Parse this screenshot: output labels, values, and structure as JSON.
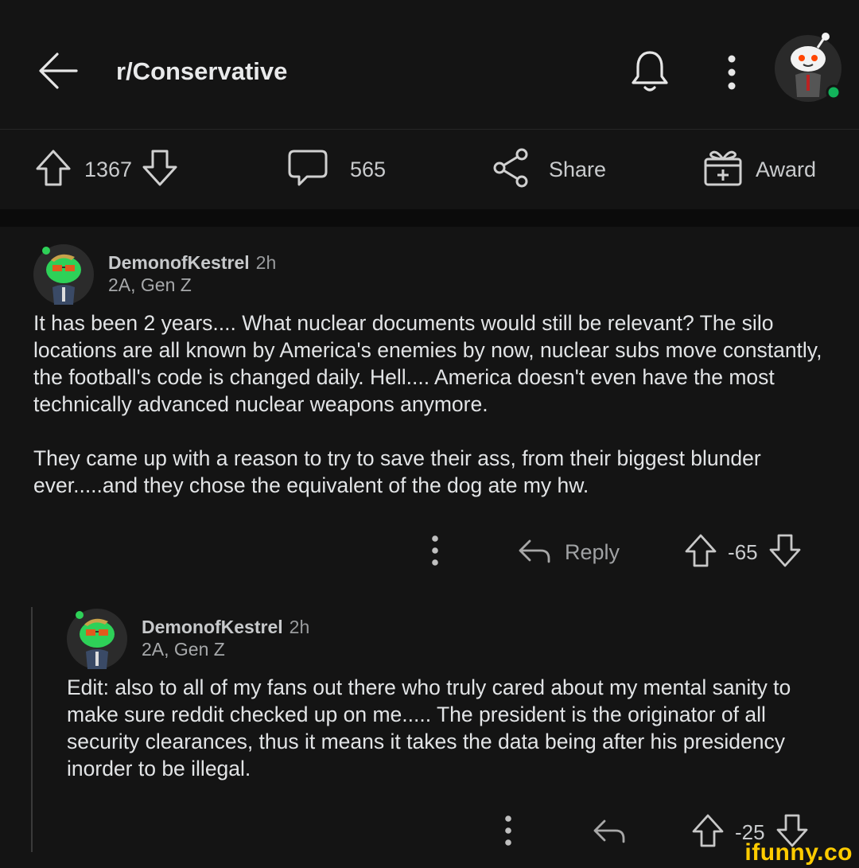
{
  "header": {
    "subreddit": "r/Conservative",
    "icons": [
      "back-arrow-icon",
      "bell-icon",
      "more-vertical-icon",
      "avatar"
    ]
  },
  "post_actions": {
    "upvotes": "1367",
    "comments": "565",
    "share_label": "Share",
    "award_label": "Award"
  },
  "comments": [
    {
      "username": "DemonofKestrel",
      "time": "2h",
      "flair": "2A, Gen Z",
      "paragraphs": [
        "It has been 2 years.... What nuclear documents would still be relevant? The silo locations are all known by America's enemies by now, nuclear subs move constantly, the football's code is changed daily. Hell.... America doesn't even have the most technically advanced nuclear weapons anymore.",
        "They came up with a reason to try to save their ass, from their biggest blunder ever.....and they chose the equivalent of the dog ate my hw."
      ],
      "reply_label": "Reply",
      "score": "-65"
    },
    {
      "username": "DemonofKestrel",
      "time": "2h",
      "flair": "2A, Gen Z",
      "paragraphs": [
        "Edit: also to all of my fans out there who truly cared about my mental sanity to make sure reddit checked up on me..... The president is the originator of all security clearances, thus it means it takes the data being after his presidency inorder to be illegal."
      ],
      "score": "-25"
    }
  ],
  "watermark": "ifunny.co",
  "colors": {
    "background": "#141414",
    "text": "#e2e4e6",
    "online_dot": "#12b35a",
    "avatar_green": "#2ed158",
    "watermark": "#ffcc00"
  }
}
